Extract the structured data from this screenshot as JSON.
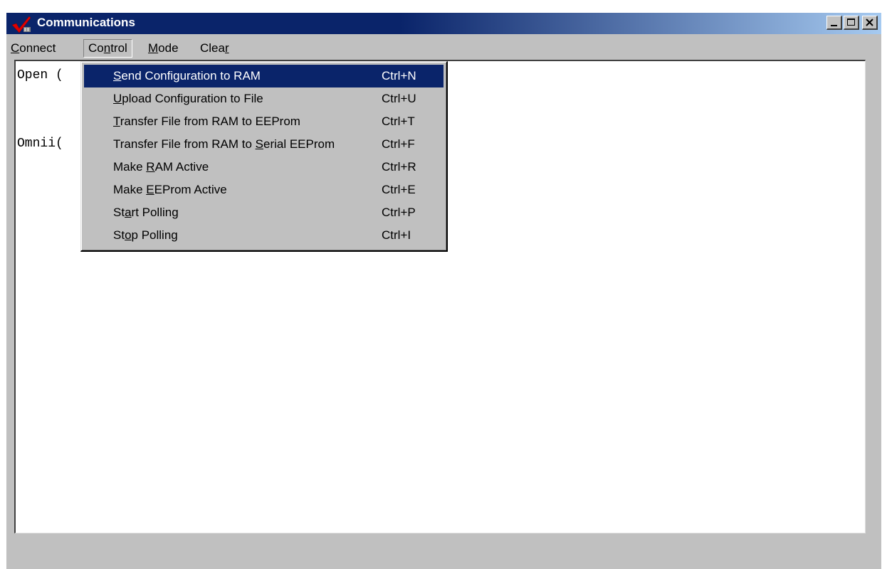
{
  "window": {
    "title": "Communications",
    "app_icon": "red-checkmark-icon",
    "controls": {
      "minimize_icon": "minimize-icon",
      "maximize_icon": "maximize-icon",
      "close_icon": "close-icon"
    }
  },
  "menubar": {
    "connect": {
      "pre": "",
      "key": "C",
      "post": "onnect"
    },
    "control": {
      "pre": "Co",
      "key": "n",
      "post": "trol"
    },
    "mode": {
      "pre": "",
      "key": "M",
      "post": "ode"
    },
    "clear": {
      "pre": "Clea",
      "key": "r",
      "post": ""
    }
  },
  "log": {
    "lines": [
      "Open (",
      "Omnii("
    ]
  },
  "control_menu": {
    "items": [
      {
        "pre": "",
        "key": "S",
        "post": "end Configuration to RAM",
        "accel": "Ctrl+N",
        "selected": true
      },
      {
        "pre": "",
        "key": "U",
        "post": "pload Configuration to File",
        "accel": "Ctrl+U"
      },
      {
        "pre": "",
        "key": "T",
        "post": "ransfer File from RAM to EEProm",
        "accel": "Ctrl+T"
      },
      {
        "pre": "Transfer File from RAM to ",
        "key": "S",
        "post": "erial EEProm",
        "accel": "Ctrl+F"
      },
      {
        "pre": "Make ",
        "key": "R",
        "post": "AM Active",
        "accel": "Ctrl+R"
      },
      {
        "pre": "Make ",
        "key": "E",
        "post": "EProm Active",
        "accel": "Ctrl+E"
      },
      {
        "pre": "St",
        "key": "a",
        "post": "rt Polling",
        "accel": "Ctrl+P"
      },
      {
        "pre": "St",
        "key": "o",
        "post": "p Polling",
        "accel": "Ctrl+I"
      }
    ]
  },
  "colors": {
    "title_active": "#0a246a",
    "title_gradient_end": "#a6caf0",
    "face": "#c0c0c0",
    "highlight": "#0a246a"
  }
}
